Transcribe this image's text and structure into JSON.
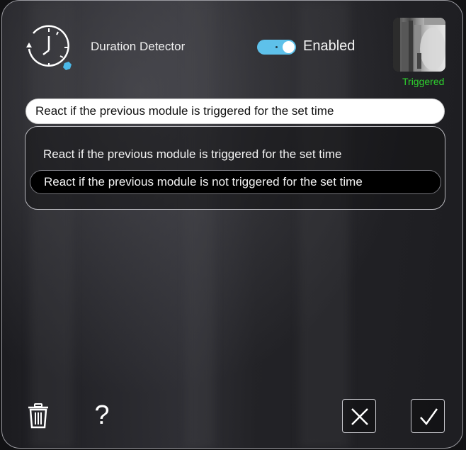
{
  "module": {
    "title": "Duration Detector",
    "icon": "clock-timer-icon"
  },
  "toggle": {
    "state": true,
    "label": "Enabled",
    "color": "#5ec1ea"
  },
  "preview": {
    "icon": "camera-thumbnail",
    "status": "Triggered",
    "status_color": "#2ed12e"
  },
  "select": {
    "value": "React if the previous module is triggered for the set time",
    "options": [
      "React if the previous module is triggered for the set time",
      "React if the previous module is not triggered for the set time"
    ],
    "highlighted_index": 1
  },
  "footer": {
    "delete_icon": "trash-icon",
    "help_label": "?",
    "cancel_icon": "close-icon",
    "confirm_icon": "check-icon"
  }
}
